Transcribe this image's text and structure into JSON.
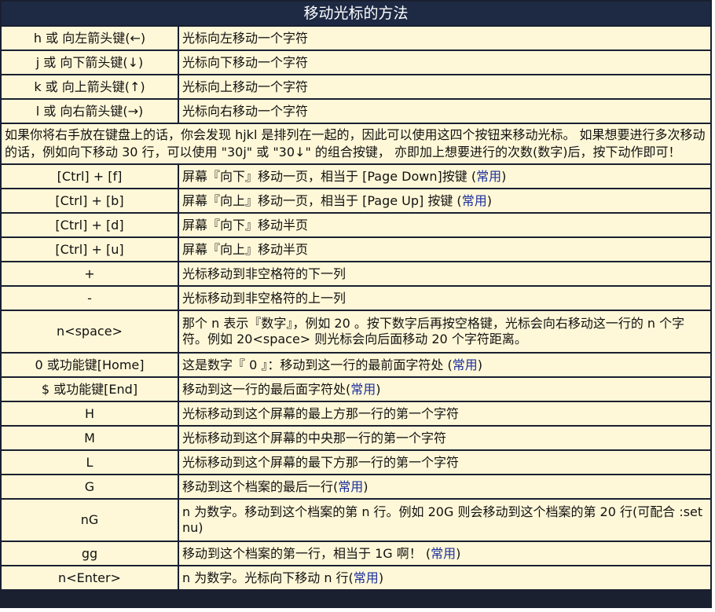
{
  "title": "移动光标的方法",
  "rows_top": [
    {
      "key": "h 或 向左箭头键(←)",
      "desc": "光标向左移动一个字符",
      "suffix": ""
    },
    {
      "key": "j 或 向下箭头键(↓)",
      "desc": "光标向下移动一个字符",
      "suffix": ""
    },
    {
      "key": "k 或 向上箭头键(↑)",
      "desc": "光标向上移动一个字符",
      "suffix": ""
    },
    {
      "key": "l 或 向右箭头键(→)",
      "desc": "光标向右移动一个字符",
      "suffix": ""
    }
  ],
  "note": "如果你将右手放在键盘上的话，你会发现 hjkl 是排列在一起的，因此可以使用这四个按钮来移动光标。 如果想要进行多次移动的话，例如向下移动 30 行，可以使用 \"30j\" 或 \"30↓\" 的组合按键， 亦即加上想要进行的次数(数字)后，按下动作即可！",
  "rows_bottom": [
    {
      "key": "[Ctrl] + [f]",
      "desc": "屏幕『向下』移动一页，相当于 [Page Down]按键 (",
      "hl": "常用",
      "end": ")"
    },
    {
      "key": "[Ctrl] + [b]",
      "desc": "屏幕『向上』移动一页，相当于 [Page Up] 按键 (",
      "hl": "常用",
      "end": ")"
    },
    {
      "key": "[Ctrl] + [d]",
      "desc": "屏幕『向下』移动半页",
      "hl": "",
      "end": ""
    },
    {
      "key": "[Ctrl] + [u]",
      "desc": "屏幕『向上』移动半页",
      "hl": "",
      "end": ""
    },
    {
      "key": "+",
      "desc": "光标移动到非空格符的下一列",
      "hl": "",
      "end": ""
    },
    {
      "key": "-",
      "desc": "光标移动到非空格符的上一列",
      "hl": "",
      "end": ""
    },
    {
      "key": "n<space>",
      "desc": "那个 n 表示『数字』，例如 20 。按下数字后再按空格键，光标会向右移动这一行的 n 个字符。例如 20<space> 则光标会向后面移动 20 个字符距离。",
      "hl": "",
      "end": "",
      "tall": true
    },
    {
      "key": "0 或功能键[Home]",
      "desc": "这是数字『 0 』：移动到这一行的最前面字符处 (",
      "hl": "常用",
      "end": ")"
    },
    {
      "key": "$ 或功能键[End]",
      "desc": "移动到这一行的最后面字符处(",
      "hl": "常用",
      "end": ")"
    },
    {
      "key": "H",
      "desc": "光标移动到这个屏幕的最上方那一行的第一个字符",
      "hl": "",
      "end": ""
    },
    {
      "key": "M",
      "desc": "光标移动到这个屏幕的中央那一行的第一个字符",
      "hl": "",
      "end": ""
    },
    {
      "key": "L",
      "desc": "光标移动到这个屏幕的最下方那一行的第一个字符",
      "hl": "",
      "end": ""
    },
    {
      "key": "G",
      "desc": "移动到这个档案的最后一行(",
      "hl": "常用",
      "end": ")"
    },
    {
      "key": "nG",
      "desc": "n 为数字。移动到这个档案的第 n 行。例如 20G 则会移动到这个档案的第 20 行(可配合 :set nu)",
      "hl": "",
      "end": "",
      "tall": true
    },
    {
      "key": "gg",
      "desc": "移动到这个档案的第一行，相当于 1G 啊！ (",
      "hl": "常用",
      "end": ")"
    },
    {
      "key": "n<Enter>",
      "desc": "n 为数字。光标向下移动 n 行(",
      "hl": "常用",
      "end": ")"
    }
  ]
}
